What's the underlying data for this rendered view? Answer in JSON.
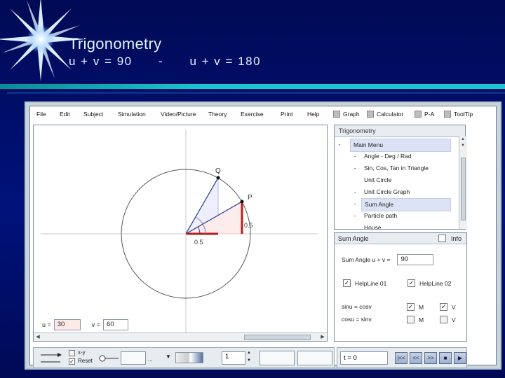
{
  "slide": {
    "title": "Trigonometry",
    "subtitle": "u + v = 90      -      u + v = 180"
  },
  "menu": {
    "items": [
      "File",
      "Edit",
      "Subject",
      "Simulation",
      "Video/Picture",
      "Theory",
      "Exercise",
      "Print",
      "Help"
    ],
    "toggles": [
      "Graph",
      "Calculator",
      "P-A",
      "ToolTip"
    ]
  },
  "graph": {
    "point_q": "Q",
    "point_p": "P",
    "label_x": "0.5",
    "label_y": "0.5",
    "u_label": "u =",
    "u_value": "30",
    "v_label": "v =",
    "v_value": "60"
  },
  "menulist": {
    "header": "Trigonometry",
    "items": [
      {
        "dash": "-",
        "label": "Main Menu"
      },
      {
        "dash": "-",
        "label": "Angle - Deg / Rad"
      },
      {
        "dash": "-",
        "label": "Sin, Cos, Tan in Triangle"
      },
      {
        "dash": "",
        "label": "Unit Circle"
      },
      {
        "dash": "-",
        "label": "Unit Circle Graph"
      },
      {
        "dash": "-",
        "label": "Sum Angle"
      },
      {
        "dash": "-",
        "label": "Particle path"
      },
      {
        "dash": "",
        "label": "House"
      }
    ]
  },
  "panel": {
    "title": "Sum Angle",
    "info": "Info",
    "sum_label": "Sum Angle u + v =",
    "sum_value": "90",
    "helpline1": "HelpLine 01",
    "helpline2": "HelpLine 02",
    "eq1": "sinu = cosv",
    "eq2": "cosu = sinv",
    "m": "M",
    "v": "V",
    "checks": {
      "helpline1": true,
      "helpline2": true,
      "eq1_m": true,
      "eq1_v": true,
      "eq2_m": false,
      "eq2_v": false
    }
  },
  "bottombar": {
    "xy": "x-y",
    "reset": "Reset",
    "dots": "...",
    "step_value": "1"
  },
  "player": {
    "time": "t = 0",
    "buttons": [
      "|<<",
      "<<",
      ">>",
      "■",
      "▶"
    ]
  },
  "colors": {
    "accent_red": "#b71c1c",
    "accent_blue": "#1f3a93",
    "highlight": "#dde3f4"
  }
}
